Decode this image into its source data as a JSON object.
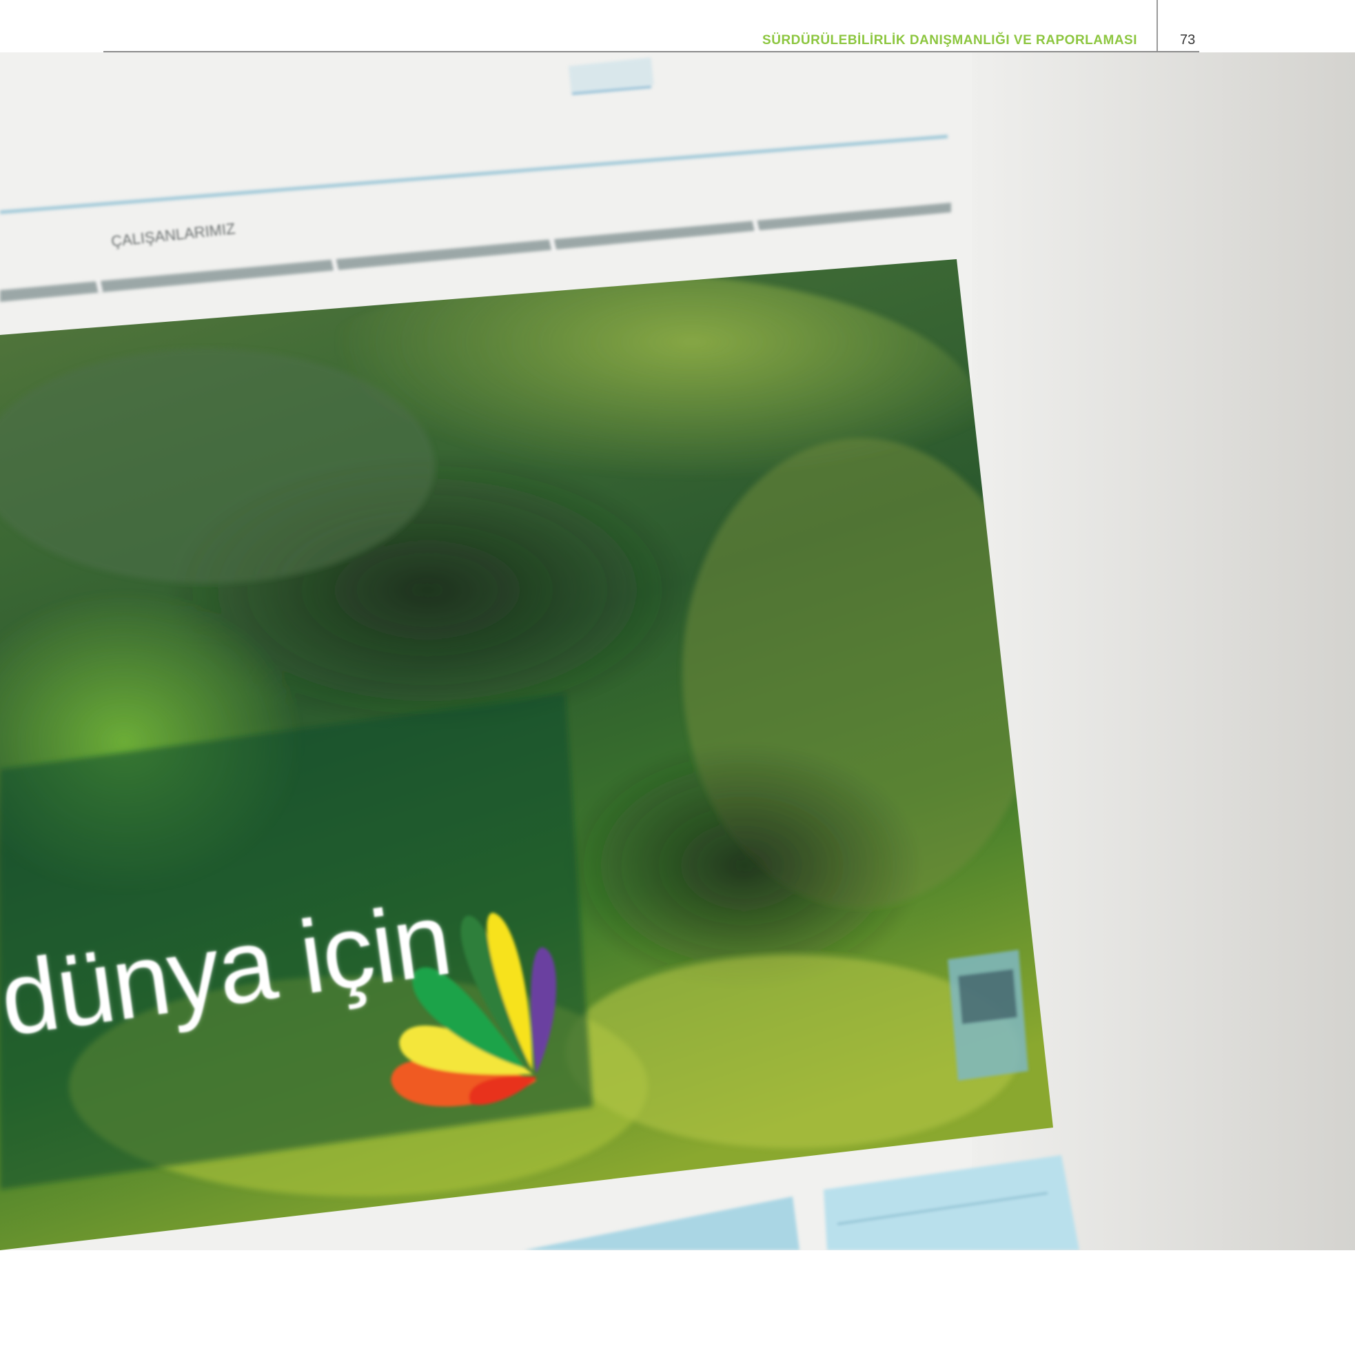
{
  "header": {
    "section_title": "SÜRDÜRÜLEBİLİRLİK DANIŞMANLIĞI VE RAPORLAMASI",
    "page_number": "73",
    "accent_color": "#8cc63f"
  },
  "photo": {
    "screen_nav": {
      "items": [
        "ÇALIŞANLARIMIZ"
      ]
    },
    "banner_text": "dünya için",
    "logo_icon": "multicolor-leaf-icon"
  }
}
